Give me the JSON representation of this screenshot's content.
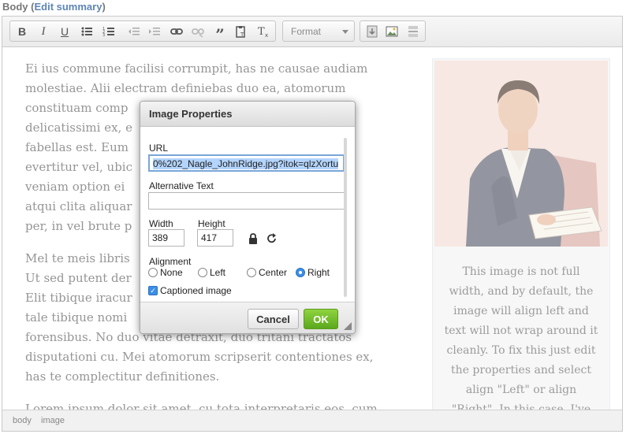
{
  "field": {
    "label": "Body",
    "open_paren": "(",
    "edit_link": "Edit summary",
    "close_paren": ")"
  },
  "toolbar": {
    "format_label": "Format",
    "buttons": [
      "bold-icon",
      "italic-icon",
      "underline-icon",
      "bullet-list-icon",
      "numbered-list-icon",
      "outdent-icon",
      "indent-icon",
      "link-icon",
      "unlink-icon",
      "blockquote-icon",
      "paste-text-icon",
      "remove-format-icon",
      "insert-template-icon",
      "image-icon",
      "horizontal-rule-icon"
    ]
  },
  "content": {
    "p1_lines": [
      "Ei ius commune facilisi corrumpit, has ne causae audiam",
      "molestiae. Alii electram definiebas duo ea, atomorum",
      "constituam comp",
      "delicatissimi ex, e                                             octus",
      "fabellas est. Eum                                             venire",
      "evertitur vel, ubic                                          Autem",
      "veniam option ei                                            ne, ius",
      "atqui clita aliquar                                          aturque",
      "per, in vel brute p"
    ],
    "p2_lines": [
      "Mel te meis libris                                           tetuer.",
      "Ut sed putent der                                             ne duo.",
      "Elit tibique iracur                                          nt te,",
      "tale tibique nomi",
      "forensibus. No duo vitae detraxit, duo tritani tractatos",
      "disputationi cu. Mei atomorum scripserit contentiones ex,",
      "has te complectitur definitiones."
    ],
    "p3_lines": [
      "Lorem ipsum dolor sit amet, cu tota interpretaris eos, cum"
    ],
    "caption_lines": [
      "This image is not full",
      "width, and by default, the",
      "image will align left and",
      "text will not wrap around it",
      "cleanly. To fix this just edit",
      "the properties and select",
      "align \"Left\" or align",
      "\"Right\". In this case, I've"
    ]
  },
  "statusbar": {
    "path": [
      "body",
      "image"
    ]
  },
  "dialog": {
    "title": "Image Properties",
    "url_label": "URL",
    "url_value": "0%202_Nagle_JohnRidge.jpg?itok=qlzXortu",
    "alt_label": "Alternative Text",
    "alt_value": "",
    "width_label": "Width",
    "width_value": "389",
    "height_label": "Height",
    "height_value": "417",
    "alignment_label": "Alignment",
    "align_options": [
      "None",
      "Left",
      "Center",
      "Right"
    ],
    "align_selected": "Right",
    "captioned_label": "Captioned image",
    "captioned_checked": true,
    "cancel_label": "Cancel",
    "ok_label": "OK"
  },
  "colors": {
    "ok_button": "#6cbd2a",
    "selection": "#b3d4fc",
    "link": "#5d86b6"
  }
}
